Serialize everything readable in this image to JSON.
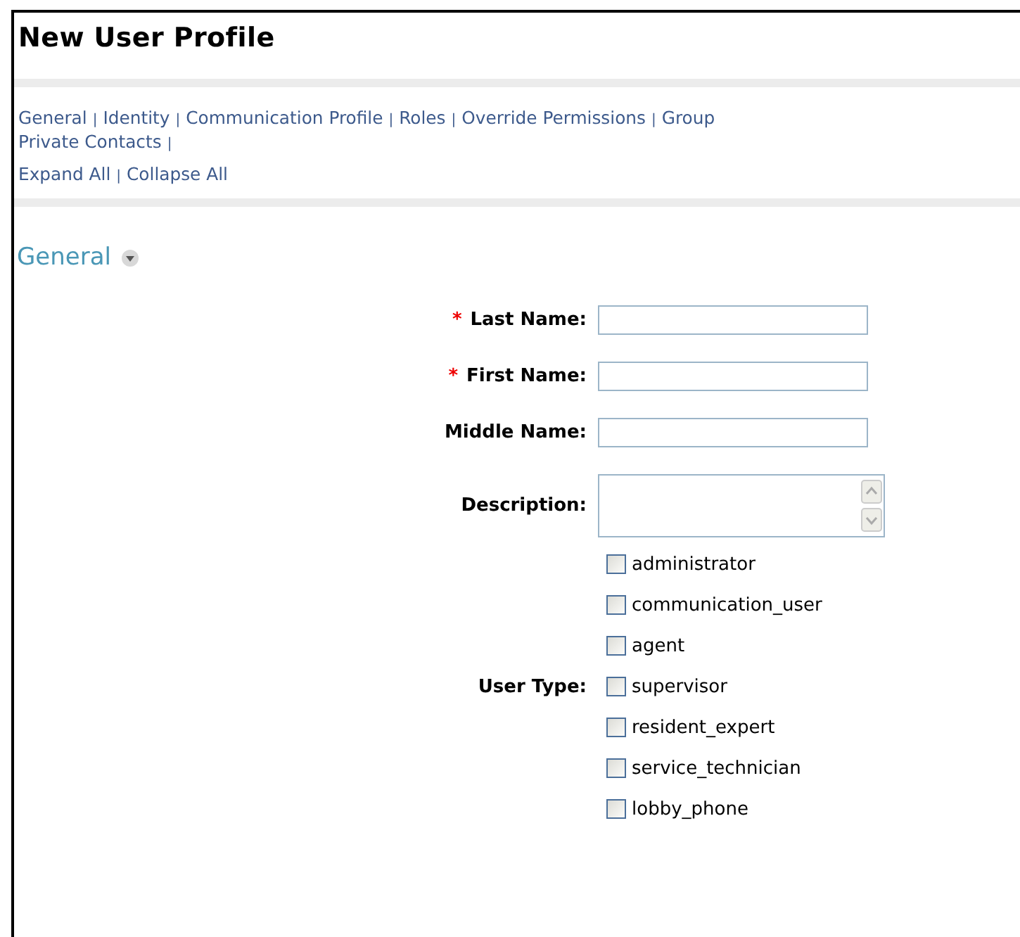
{
  "page": {
    "title": "New User Profile"
  },
  "nav_lines": [
    [
      {
        "kind": "link",
        "text": "General"
      },
      {
        "kind": "separator",
        "text": "|"
      },
      {
        "kind": "link",
        "text": "Identity"
      },
      {
        "kind": "separator",
        "text": "|"
      },
      {
        "kind": "link",
        "text": "Communication Profile"
      },
      {
        "kind": "separator",
        "text": "|"
      },
      {
        "kind": "link",
        "text": "Roles"
      },
      {
        "kind": "separator",
        "text": "|"
      },
      {
        "kind": "link",
        "text": "Override Permissions"
      },
      {
        "kind": "separator",
        "text": "|"
      },
      {
        "kind": "link",
        "text": "Group"
      }
    ],
    [
      {
        "kind": "link",
        "text": "Private Contacts"
      },
      {
        "kind": "separator",
        "text": "|"
      }
    ],
    [
      {
        "kind": "link",
        "text": "Expand All"
      },
      {
        "kind": "separator",
        "text": "|"
      },
      {
        "kind": "link",
        "text": "Collapse All"
      }
    ]
  ],
  "section": {
    "title": "General",
    "expanded": true,
    "fields": [
      {
        "kind": "text",
        "label": "Last Name:",
        "required_mark": "*"
      },
      {
        "kind": "text",
        "label": "First Name:",
        "required_mark": "*"
      },
      {
        "kind": "text",
        "label": "Middle Name:"
      },
      {
        "kind": "textarea",
        "label": "Description:"
      }
    ],
    "user_type": {
      "label": "User Type:",
      "options": [
        {
          "label": "administrator",
          "checked": false
        },
        {
          "label": "communication_user",
          "checked": false
        },
        {
          "label": "agent",
          "checked": false
        },
        {
          "label": "supervisor",
          "checked": false
        },
        {
          "label": "resident_expert",
          "checked": false
        },
        {
          "label": "service_technician",
          "checked": false
        },
        {
          "label": "lobby_phone",
          "checked": false
        }
      ]
    }
  }
}
